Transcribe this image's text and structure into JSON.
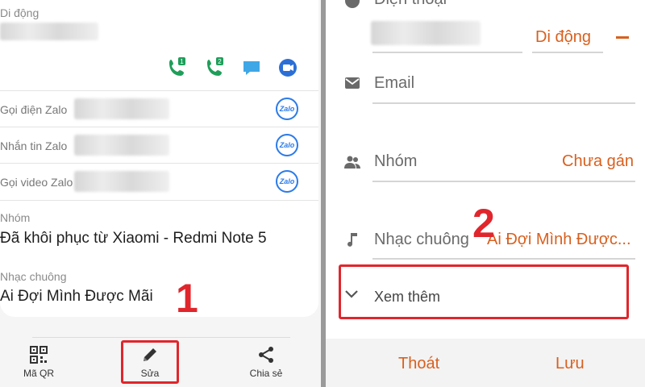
{
  "left": {
    "phone_type_label": "Di động",
    "zalo_rows": [
      {
        "label": "Gọi điện Zalo",
        "badge": "Zalo"
      },
      {
        "label": "Nhắn tin Zalo",
        "badge": "Zalo"
      },
      {
        "label": "Gọi video Zalo",
        "badge": "Zalo"
      }
    ],
    "call_sim1_badge": "1",
    "call_sim2_badge": "2",
    "group_label": "Nhóm",
    "group_value": "Đã khôi phục từ Xiaomi - Redmi Note 5",
    "ringtone_label": "Nhạc chuông",
    "ringtone_value": "Ai Đợi Mình Được Mãi",
    "bottom_nav": {
      "qr_label": "Mã QR",
      "edit_label": "Sửa",
      "share_label": "Chia sẻ"
    },
    "step_number": "1"
  },
  "right": {
    "phone_label": "Điện thoại",
    "phone_type": "Di động",
    "email_label": "Email",
    "group_label": "Nhóm",
    "group_value": "Chưa gán",
    "ringtone_label": "Nhạc chuông",
    "ringtone_value": "Ai Đợi Mình Được...",
    "see_more_label": "Xem thêm",
    "exit_label": "Thoát",
    "save_label": "Lưu",
    "step_number": "2"
  },
  "colors": {
    "accent_orange": "#d8601f",
    "highlight_red": "#e0262c",
    "call_green": "#1f9e5a",
    "zalo_blue": "#2b7be9"
  }
}
